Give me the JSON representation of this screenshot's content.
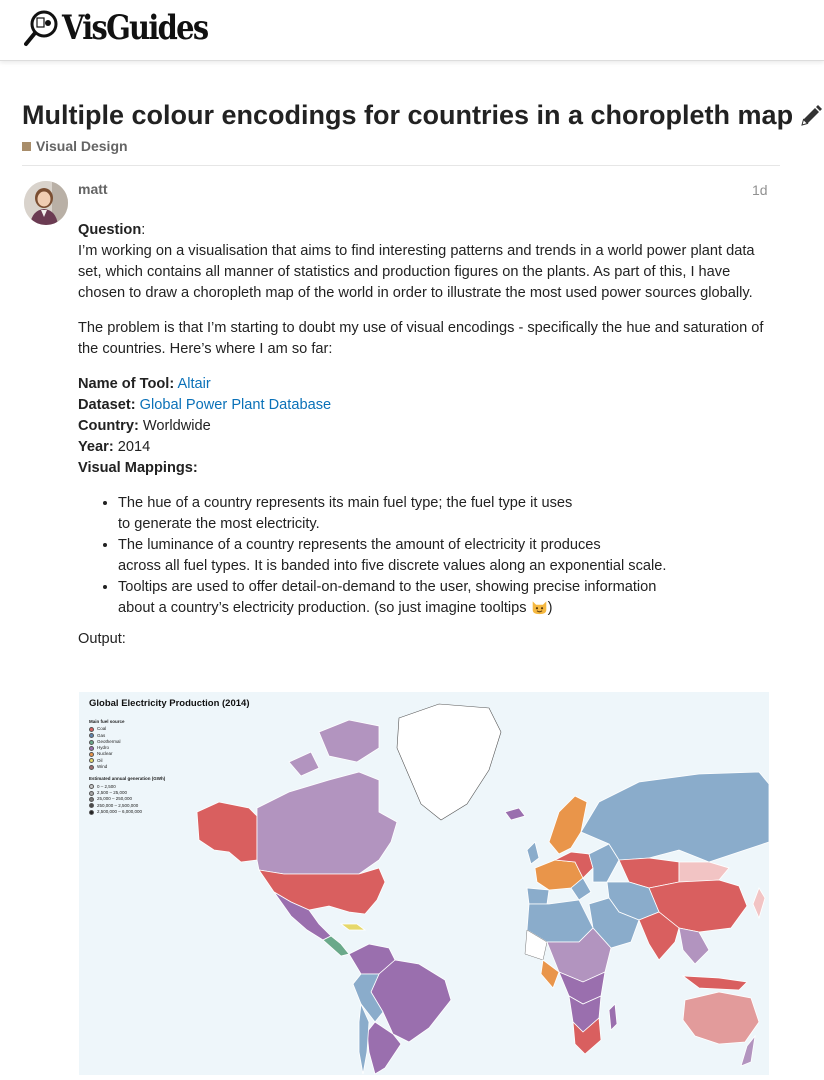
{
  "site": {
    "logo_text": "VisGuides",
    "logo_icon": "magnifier-glass-icon"
  },
  "topic": {
    "title": "Multiple colour encodings for countries in a choropleth map",
    "edit_icon": "pencil-icon",
    "category": {
      "label": "Visual Design",
      "color": "#a88d6a"
    }
  },
  "post": {
    "author": "matt",
    "date": "1d",
    "question_label": "Question",
    "question_text": "I’m working on a visualisation that aims to find interesting patterns and trends in a world power plant data set, which contains all manner of statistics and production figures on the plants. As part of this, I have chosen to draw a choropleth map of the world in order to illustrate the most used power sources globally.",
    "problem_text": "The problem is that I’m starting to doubt my use of visual encodings - specifically the hue and saturation of the countries. Here’s where I am so far:",
    "details": {
      "tool_label": "Name of Tool:",
      "tool_value": "Altair",
      "dataset_label": "Dataset:",
      "dataset_value": "Global Power Plant Database",
      "country_label": "Country:",
      "country_value": "Worldwide",
      "year_label": "Year:",
      "year_value": "2014",
      "mappings_label": "Visual Mappings:"
    },
    "mappings": [
      {
        "line1": "The hue of a country represents its main fuel type; the fuel type it uses",
        "line2": "to generate the most electricity."
      },
      {
        "line1": "The luminance of a country represents the amount of electricity it produces",
        "line2": "across all fuel types. It is banded into five discrete values along an exponential scale."
      },
      {
        "line1": "Tooltips are used to offer detail-on-demand to the user, showing precise information",
        "line2": "about a country’s electricity production. (so just imagine tooltips"
      }
    ],
    "emoji_name": "smiley-cat-emoji",
    "tooltip_close": ")",
    "output_label": "Output:"
  },
  "map": {
    "title": "Global Electricity Production (2014)",
    "fuel_legend_title": "Main fuel source",
    "fuel_legend": [
      {
        "label": "Coal",
        "color": "#d95f5f"
      },
      {
        "label": "Gas",
        "color": "#5f86b0"
      },
      {
        "label": "Geothermal",
        "color": "#6aa98a"
      },
      {
        "label": "Hydro",
        "color": "#9a6fae"
      },
      {
        "label": "Nuclear",
        "color": "#e9954a"
      },
      {
        "label": "Oil",
        "color": "#e6d86a"
      },
      {
        "label": "Wind",
        "color": "#a07070"
      }
    ],
    "gen_legend_title": "Estimated annual generation (GWh)",
    "gen_legend": [
      {
        "label": "0 – 2,500",
        "color": "#c8c8c8"
      },
      {
        "label": "2,500 – 25,000",
        "color": "#a6a6a6"
      },
      {
        "label": "25,000 – 250,000",
        "color": "#777777"
      },
      {
        "label": "250,000 – 2,500,000",
        "color": "#4a4a4a"
      },
      {
        "label": "2,500,000 – 6,000,000",
        "color": "#222222"
      }
    ]
  }
}
